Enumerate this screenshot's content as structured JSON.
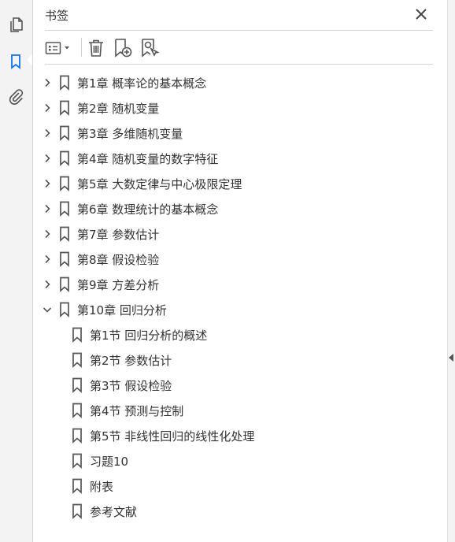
{
  "left_strip": {
    "items": [
      {
        "icon": "pages-icon",
        "active": false
      },
      {
        "icon": "bookmark-icon",
        "active": true
      },
      {
        "icon": "attachment-icon",
        "active": false
      }
    ]
  },
  "panel": {
    "title": "书签",
    "toolbar": {
      "buttons": [
        {
          "icon": "options-menu-icon"
        },
        {
          "icon": "delete-icon"
        },
        {
          "icon": "new-bookmark-icon"
        },
        {
          "icon": "find-bookmark-icon"
        }
      ]
    },
    "bookmarks": [
      {
        "label": "第1章  概率论的基本概念",
        "level": 0,
        "expanded": false,
        "has_children": true
      },
      {
        "label": "第2章  随机变量",
        "level": 0,
        "expanded": false,
        "has_children": true
      },
      {
        "label": "第3章  多维随机变量",
        "level": 0,
        "expanded": false,
        "has_children": true
      },
      {
        "label": "第4章  随机变量的数字特征",
        "level": 0,
        "expanded": false,
        "has_children": true
      },
      {
        "label": "第5章  大数定律与中心极限定理",
        "level": 0,
        "expanded": false,
        "has_children": true
      },
      {
        "label": "第6章  数理统计的基本概念",
        "level": 0,
        "expanded": false,
        "has_children": true
      },
      {
        "label": "第7章  参数估计",
        "level": 0,
        "expanded": false,
        "has_children": true
      },
      {
        "label": "第8章  假设检验",
        "level": 0,
        "expanded": false,
        "has_children": true
      },
      {
        "label": "第9章  方差分析",
        "level": 0,
        "expanded": false,
        "has_children": true
      },
      {
        "label": "第10章  回归分析",
        "level": 0,
        "expanded": true,
        "has_children": true
      },
      {
        "label": "第1节  回归分析的概述",
        "level": 1,
        "expanded": false,
        "has_children": false
      },
      {
        "label": "第2节  参数估计",
        "level": 1,
        "expanded": false,
        "has_children": false
      },
      {
        "label": "第3节  假设检验",
        "level": 1,
        "expanded": false,
        "has_children": false
      },
      {
        "label": "第4节  预测与控制",
        "level": 1,
        "expanded": false,
        "has_children": false
      },
      {
        "label": "第5节  非线性回归的线性化处理",
        "level": 1,
        "expanded": false,
        "has_children": false
      },
      {
        "label": "习题10",
        "level": 1,
        "expanded": false,
        "has_children": false
      },
      {
        "label": "附表",
        "level": 1,
        "expanded": false,
        "has_children": false
      },
      {
        "label": "参考文献",
        "level": 1,
        "expanded": false,
        "has_children": false
      }
    ]
  },
  "colors": {
    "active_icon": "#1473e6",
    "icon": "#555555",
    "text": "#333333"
  }
}
